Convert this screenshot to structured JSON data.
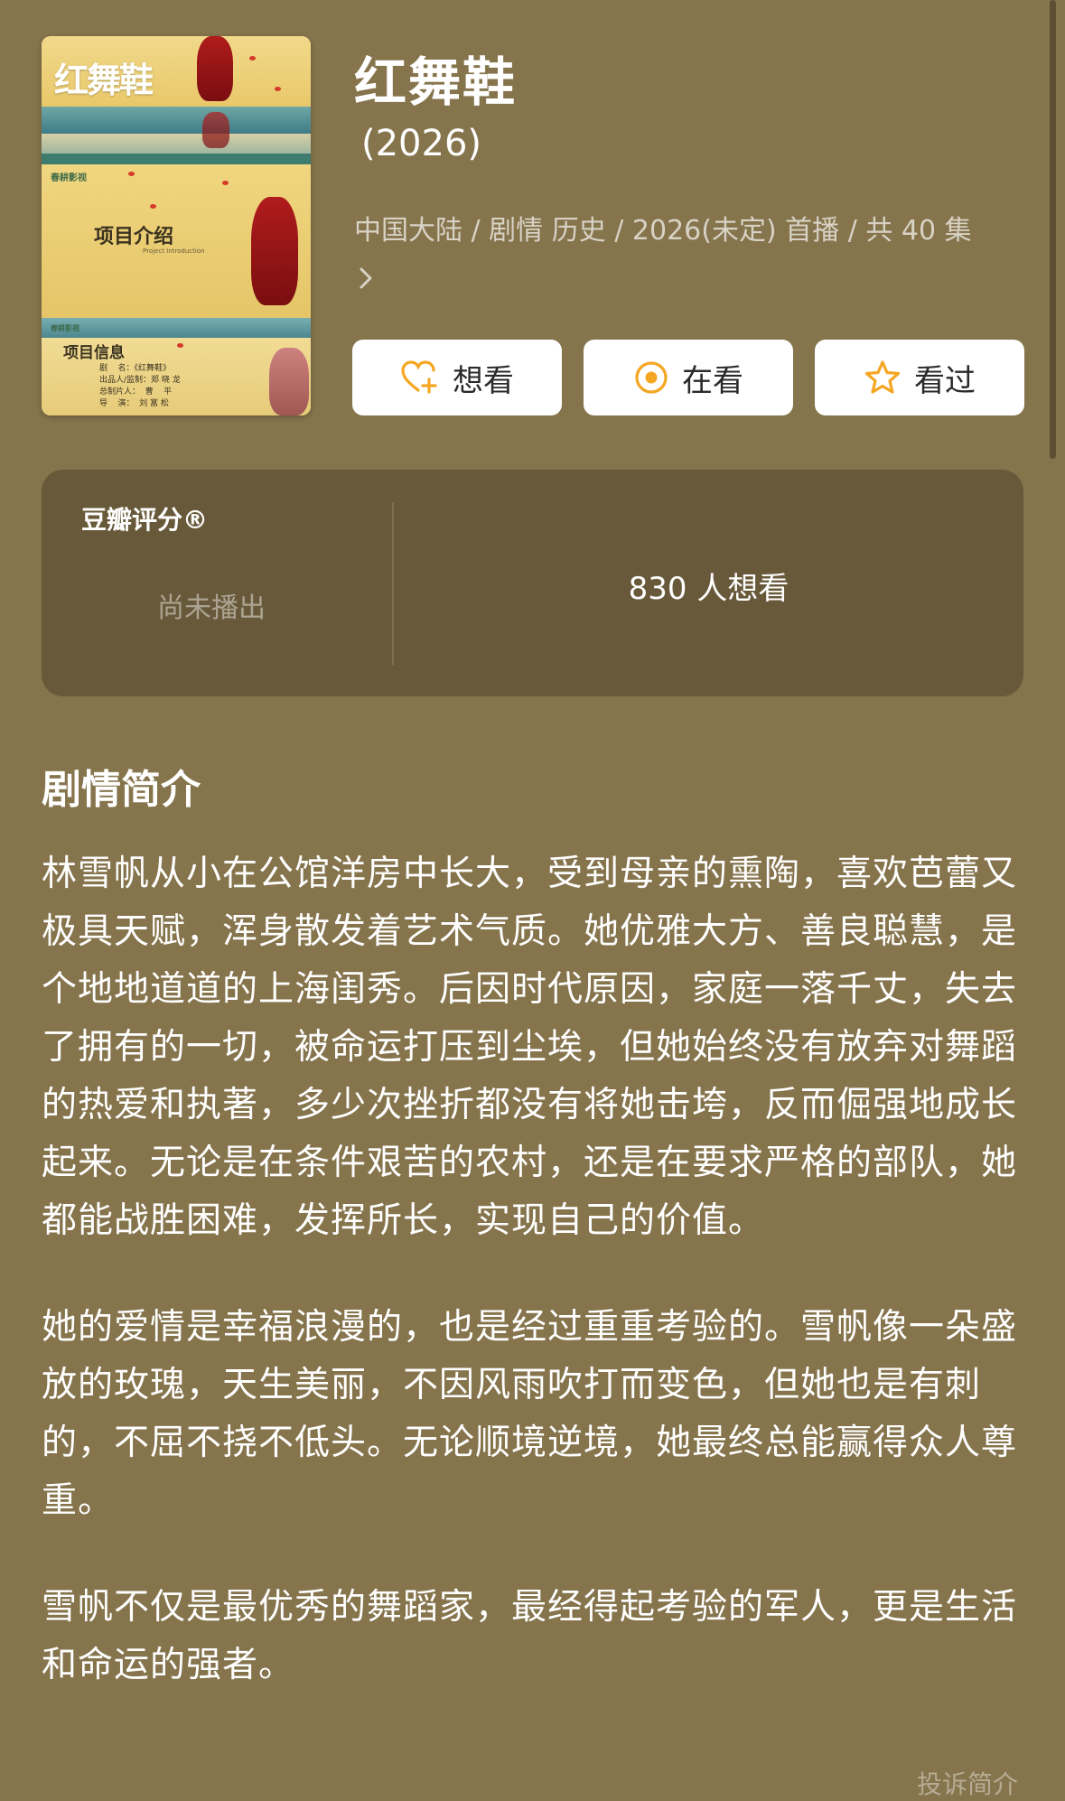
{
  "show": {
    "title": "红舞鞋",
    "year": "(2026)",
    "meta_line": "中国大陆 / 剧情 历史 / 2026(未定) 首播 / 共 40 集"
  },
  "poster": {
    "title": "红舞鞋",
    "studio": "春耕影视",
    "section1": "项目介绍",
    "section1_sub": "Project Introduction",
    "section2": "项目信息",
    "credits": "剧    名：《红舞鞋》\n出品人/监制：郑 晓 龙\n总制片人：  曹    平\n导    演：  刘 富 松"
  },
  "actions": [
    {
      "label": "想看",
      "icon": "heart-plus-icon"
    },
    {
      "label": "在看",
      "icon": "watching-circle-icon"
    },
    {
      "label": "看过",
      "icon": "star-icon"
    }
  ],
  "rating": {
    "label": "豆瓣评分®",
    "status": "尚未播出",
    "want_count": "830 人想看"
  },
  "synopsis": {
    "heading": "剧情简介",
    "paragraphs": [
      "林雪帆从小在公馆洋房中长大，受到母亲的熏陶，喜欢芭蕾又极具天赋，浑身散发着艺术气质。她优雅大方、善良聪慧，是个地地道道的上海闺秀。后因时代原因，家庭一落千丈，失去了拥有的一切，被命运打压到尘埃，但她始终没有放弃对舞蹈的热爱和执著，多少次挫折都没有将她击垮，反而倔强地成长起来。无论是在条件艰苦的农村，还是在要求严格的部队，她都能战胜困难，发挥所长，实现自己的价值。",
      "她的爱情是幸福浪漫的，也是经过重重考验的。雪帆像一朵盛放的玫瑰，天生美丽，不因风雨吹打而变色，但她也是有刺的，不屈不挠不低头。无论顺境逆境，她最终总能赢得众人尊重。",
      "雪帆不仅是最优秀的舞蹈家，最经得起考验的军人，更是生活和命运的强者。"
    ],
    "report_link": "投诉简介"
  },
  "colors": {
    "background": "#85744c",
    "rating_card": "#68593a",
    "accent_orange": "#f5a623"
  }
}
